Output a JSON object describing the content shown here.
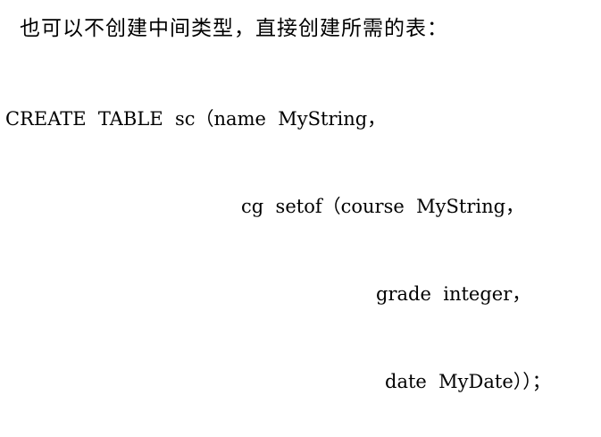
{
  "heading": "也可以不创建中间类型，直接创建所需的表：",
  "code_lines": [
    "CREATE  TABLE  sc（name  MyString，",
    "cg  setof（course  MyString，",
    "grade  integer，",
    "date  MyDate））；"
  ]
}
